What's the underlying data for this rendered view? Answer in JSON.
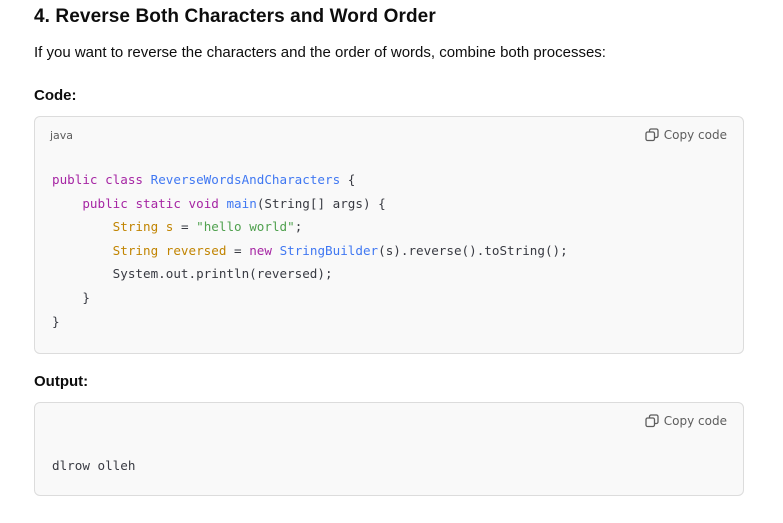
{
  "section": {
    "title": "4. Reverse Both Characters and Word Order",
    "intro": "If you want to reverse the characters and the order of words, combine both processes:",
    "code_label": "Code:",
    "output_label": "Output:"
  },
  "code_block": {
    "language": "java",
    "copy_label": "Copy code",
    "lines": [
      "public class ReverseWordsAndCharacters {",
      "    public static void main(String[] args) {",
      "        String s = \"hello world\";",
      "        String reversed = new StringBuilder(s).reverse().toString();",
      "        System.out.println(reversed);",
      "    }",
      "}"
    ]
  },
  "output_block": {
    "copy_label": "Copy code",
    "text": "dlrow olleh"
  },
  "icons": {
    "copy": "copy-icon"
  },
  "colors": {
    "keyword": "#a626a4",
    "class_name": "#4078f2",
    "type": "#c18401",
    "string": "#50a14f",
    "code_bg": "#f9f9f9"
  }
}
